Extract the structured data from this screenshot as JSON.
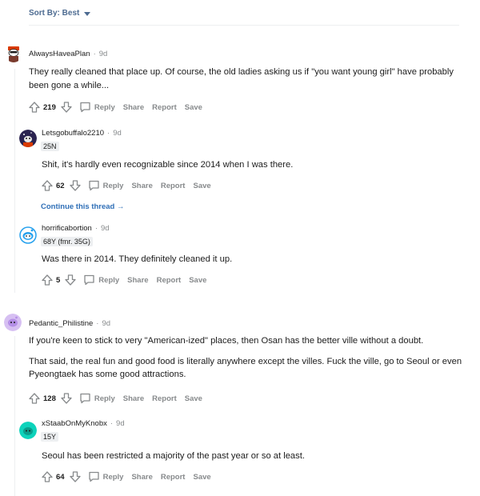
{
  "sort": {
    "label": "Sort By: Best"
  },
  "comments": [
    {
      "author": "AlwaysHaveaPlan",
      "time": "9d",
      "body": [
        "They really cleaned that place up. Of course, the old ladies asking us if \"you want young girl\" have probably been gone a while..."
      ],
      "score": "219"
    },
    {
      "author": "Letsgobuffalo2210",
      "time": "9d",
      "flair": "25N",
      "body": [
        "Shit, it's hardly even recognizable since 2014 when I was there."
      ],
      "score": "62"
    },
    {
      "author": "horrificabortion",
      "time": "9d",
      "flair": "68Y (fmr. 35G)",
      "body": [
        "Was there in 2014. They definitely cleaned it up."
      ],
      "score": "5"
    },
    {
      "author": "Pedantic_Philistine",
      "time": "9d",
      "body": [
        "If you're keen to stick to very \"American-ized\" places, then Osan has the better ville without a doubt.",
        "That said, the real fun and good food is literally anywhere except the villes. Fuck the ville, go to Seoul or even Pyeongtaek has some good attractions."
      ],
      "score": "128"
    },
    {
      "author": "xStaabOnMyKnobx",
      "time": "9d",
      "flair": "15Y",
      "body": [
        "Seoul has been restricted a majority of the past year or so at least."
      ],
      "score": "64"
    }
  ],
  "continue_thread": "Continue this thread",
  "actions": {
    "reply": "Reply",
    "share": "Share",
    "report": "Report",
    "save": "Save"
  },
  "separator": "·"
}
